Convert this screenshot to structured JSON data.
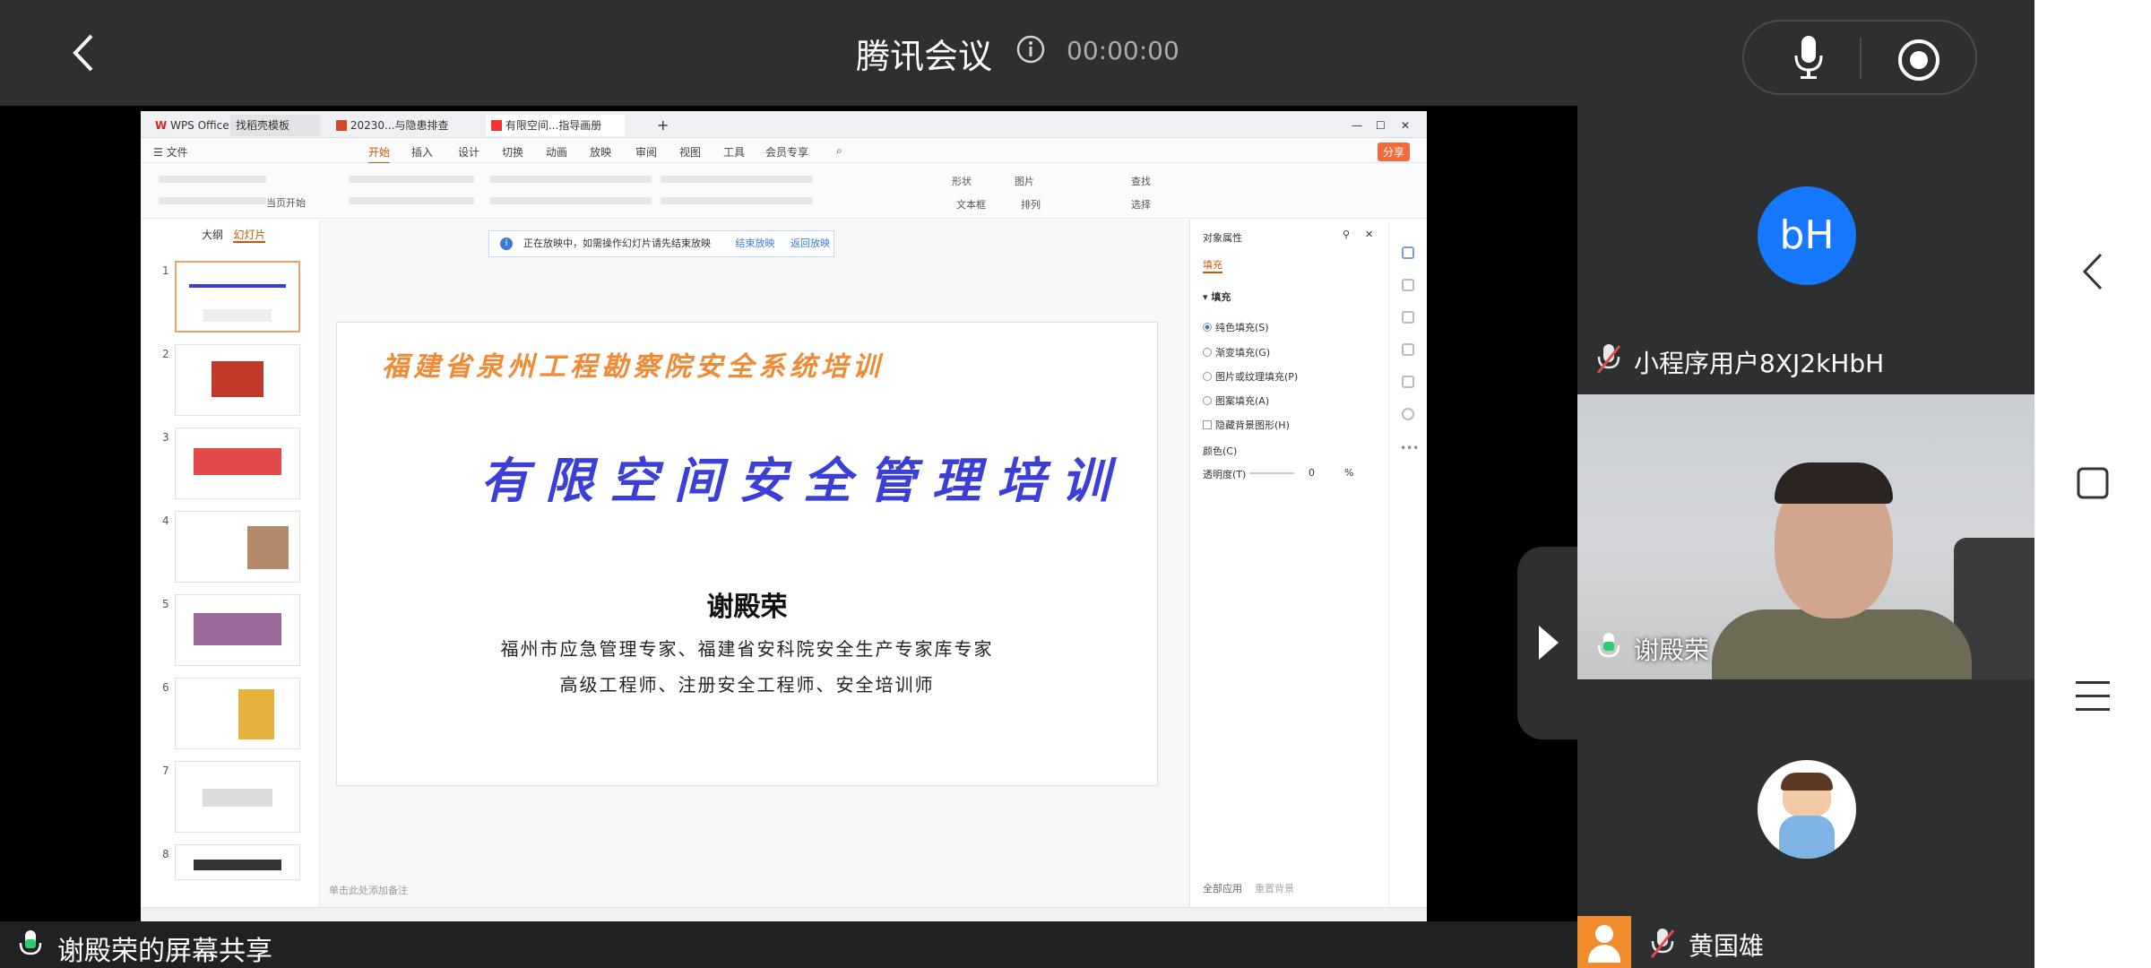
{
  "header": {
    "title": "腾讯会议",
    "timer": "00:00:00"
  },
  "wps": {
    "tabs": [
      "WPS Office",
      "找稻壳模板",
      "20230...与隐患排查",
      "有限空间...指导画册"
    ],
    "menus": [
      "文件",
      "开始",
      "插入",
      "设计",
      "切换",
      "动画",
      "放映",
      "审阅",
      "视图",
      "工具",
      "会员专享"
    ],
    "share": "分享",
    "ribbon": {
      "from_current": "当页开始",
      "shape": "形状",
      "picture": "图片",
      "find": "查找",
      "textbox": "文本框",
      "arrange": "排列",
      "select": "选择"
    },
    "left_tabs": {
      "outline": "大纲",
      "slides": "幻灯片"
    },
    "slide_numbers": [
      "1",
      "2",
      "3",
      "4",
      "5",
      "6",
      "7",
      "8"
    ],
    "banner": {
      "text": "正在放映中，如需操作幻灯片请先结束放映",
      "end": "结束放映",
      "return": "返回放映"
    },
    "slide": {
      "subtitle": "福建省泉州工程勘察院安全系统培训",
      "title": "有限空间安全管理培训",
      "presenter": "谢殿荣",
      "line1": "福州市应急管理专家、福建省安科院安全生产专家库专家",
      "line2": "高级工程师、注册安全工程师、安全培训师"
    },
    "notes_placeholder": "单击此处添加备注",
    "props": {
      "title": "对象属性",
      "tab_fill": "填充",
      "fill_section": "填充",
      "opt_solid": "纯色填充(S)",
      "opt_gradient": "渐变填充(G)",
      "opt_picture": "图片或纹理填充(P)",
      "opt_pattern": "图案填充(A)",
      "opt_hide": "隐藏背景图形(H)",
      "color": "颜色(C)",
      "transparency": "透明度(T)",
      "transparency_value": "0",
      "percent": "%",
      "apply_all": "全部应用",
      "reset_bg": "重置背景"
    }
  },
  "participants": [
    {
      "initials": "bH",
      "name": "小程序用户8XJ2kHbH"
    },
    {
      "name": "谢殿荣"
    },
    {
      "name": "黄国雄"
    }
  ],
  "share_label": "谢殿荣的屏幕共享",
  "colors": {
    "accent": "#1677ff",
    "slide_orange": "#ef8a35",
    "slide_blue": "#3b3fd6"
  }
}
